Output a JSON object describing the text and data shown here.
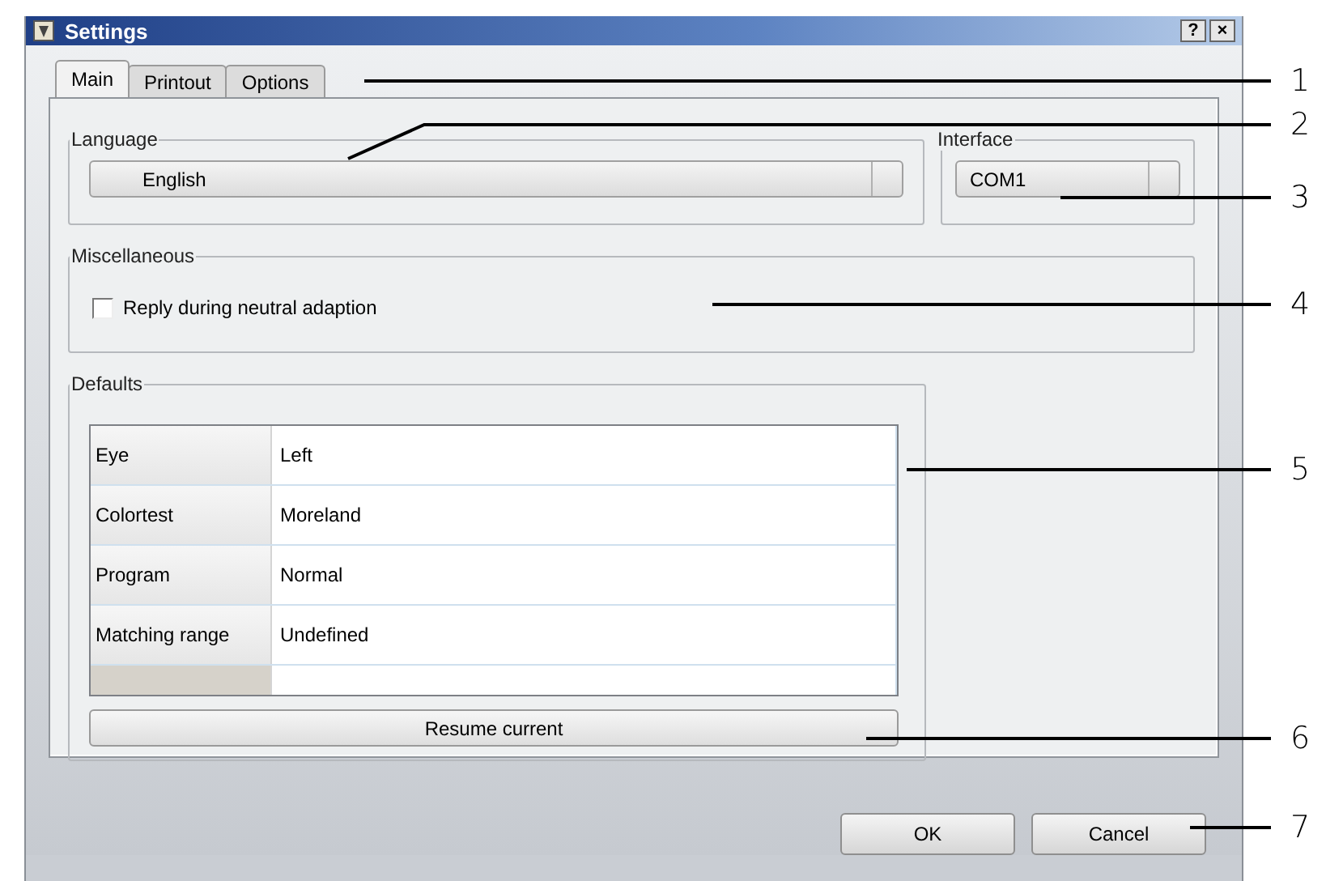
{
  "window": {
    "title": "Settings",
    "title_buttons": [
      "?",
      "×"
    ]
  },
  "tabs": [
    {
      "label": "Main",
      "selected": true
    },
    {
      "label": "Printout",
      "selected": false
    },
    {
      "label": "Options",
      "selected": false
    }
  ],
  "language": {
    "legend": "Language",
    "value": "English"
  },
  "interface": {
    "legend": "Interface",
    "value": "COM1"
  },
  "miscellaneous": {
    "legend": "Miscellaneous",
    "checkbox": {
      "label": "Reply during neutral adaption",
      "checked": false
    }
  },
  "defaults": {
    "legend": "Defaults",
    "rows": [
      {
        "name": "Eye",
        "value": "Left"
      },
      {
        "name": "Colortest",
        "value": "Moreland"
      },
      {
        "name": "Program",
        "value": "Normal"
      },
      {
        "name": "Matching range",
        "value": "Undefined"
      }
    ],
    "button": "Resume current"
  },
  "buttons": [
    "OK",
    "Cancel"
  ],
  "callouts": [
    "1",
    "2",
    "3",
    "4",
    "5",
    "6",
    "7"
  ]
}
